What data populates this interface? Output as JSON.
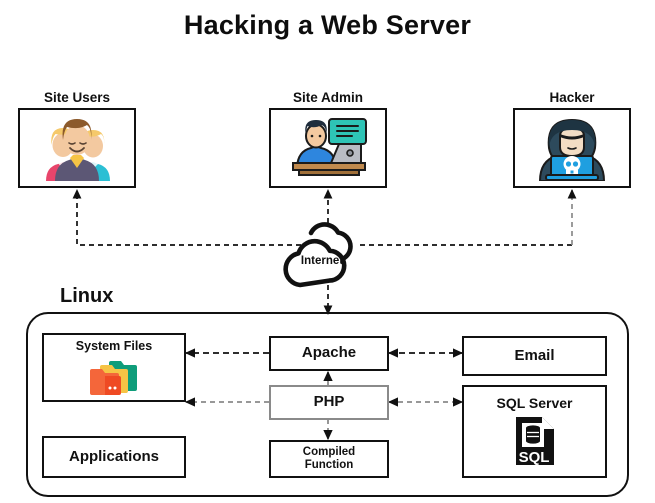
{
  "diagram": {
    "title": "Hacking a Web Server",
    "type": "network-security-diagram"
  },
  "actors": [
    {
      "id": "site-users",
      "label": "Site Users",
      "icon": "group-of-people-icon",
      "icon_colors": {
        "left": "#e8456b",
        "center": "#5c5775",
        "right": "#2bbfd4",
        "hair": "#f5c96b",
        "hair_center": "#8c5a2b",
        "skin": "#f3c9a0"
      }
    },
    {
      "id": "site-admin",
      "label": "Site Admin",
      "icon": "admin-at-desk-icon",
      "icon_colors": {
        "shirt": "#2e86de",
        "desk": "#c08a4e",
        "laptop": "#b9bcc4",
        "bubble": "#2ec4b6",
        "hair": "#1f2d3d"
      }
    },
    {
      "id": "hacker",
      "label": "Hacker",
      "icon": "hooded-hacker-icon",
      "icon_colors": {
        "hood": "#2d4a5c",
        "hood_dark": "#1e3442",
        "laptop": "#1f9fe0",
        "skull": "#ffffff",
        "skin": "#f3ddc4"
      }
    }
  ],
  "cloud": {
    "label": "Internet",
    "icon": "cloud-icon"
  },
  "linux": {
    "label": "Linux",
    "nodes": [
      {
        "id": "system-files",
        "label": "System Files",
        "icon": "folders-icon",
        "border": "#111111",
        "icon_colors": {
          "back": "#0f9d7a",
          "middle": "#f6c445",
          "front": "#f4663a",
          "front_dark": "#ef4a23"
        }
      },
      {
        "id": "applications",
        "label": "Applications",
        "icon": null,
        "border": "#111111"
      },
      {
        "id": "apache",
        "label": "Apache",
        "icon": null,
        "border": "#111111"
      },
      {
        "id": "php",
        "label": "PHP",
        "icon": null,
        "border": "#8a8a8a"
      },
      {
        "id": "compiled-function",
        "label": "Compiled\nFunction",
        "label_line1": "Compiled",
        "label_line2": "Function",
        "icon": null,
        "border": "#111111"
      },
      {
        "id": "email",
        "label": "Email",
        "icon": null,
        "border": "#111111"
      },
      {
        "id": "sql-server",
        "label": "SQL Server",
        "icon": "sql-database-file-icon",
        "border": "#111111",
        "icon_text": "SQL",
        "icon_colors": {
          "fill": "#111111",
          "text": "#ffffff"
        }
      }
    ]
  },
  "connections": [
    {
      "id": "internet-to-site-users",
      "from": "internet",
      "to": "site-users",
      "style": "dashed",
      "color": "#111111",
      "direction": "to-target"
    },
    {
      "id": "internet-to-site-admin",
      "from": "internet",
      "to": "site-admin",
      "style": "dashed",
      "color": "#111111",
      "direction": "to-target"
    },
    {
      "id": "internet-to-hacker",
      "from": "internet",
      "to": "hacker",
      "style": "dashed",
      "color": "#8a8a8a",
      "direction": "to-target"
    },
    {
      "id": "internet-to-linux",
      "from": "internet",
      "to": "linux",
      "style": "dashed",
      "color": "#111111",
      "direction": "to-target"
    },
    {
      "id": "apache-to-system-files",
      "from": "apache",
      "to": "system-files",
      "style": "dashed",
      "color": "#111111",
      "direction": "to-target"
    },
    {
      "id": "php-to-system-files",
      "from": "php",
      "to": "system-files",
      "style": "dashed",
      "color": "#8a8a8a",
      "direction": "to-target"
    },
    {
      "id": "apache-email",
      "from": "apache",
      "to": "email",
      "style": "dashed",
      "color": "#111111",
      "direction": "bidirectional"
    },
    {
      "id": "php-sql-server",
      "from": "php",
      "to": "sql-server",
      "style": "dashed",
      "color": "#8a8a8a",
      "direction": "bidirectional"
    },
    {
      "id": "php-to-apache",
      "from": "php",
      "to": "apache",
      "style": "dashed",
      "color": "#8a8a8a",
      "direction": "to-target"
    },
    {
      "id": "php-to-compiled-function",
      "from": "php",
      "to": "compiled-function",
      "style": "dashed",
      "color": "#8a8a8a",
      "direction": "to-target"
    }
  ],
  "colors": {
    "background": "#ffffff",
    "stroke": "#111111",
    "stroke_gray": "#8a8a8a",
    "text": "#111111"
  }
}
